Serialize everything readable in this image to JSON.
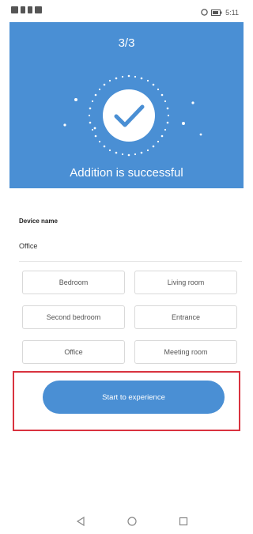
{
  "status_bar": {
    "time": "5:11",
    "icons": [
      "signal-icon",
      "wifi-icon",
      "notification-icon",
      "alarm-icon",
      "battery-icon"
    ]
  },
  "setup": {
    "step": "3/3",
    "success_message": "Addition is successful",
    "icon": "checkmark-icon",
    "colors": {
      "accent": "#4a8fd4",
      "highlight": "#d9333f"
    }
  },
  "device": {
    "label": "Device name",
    "value": "Office"
  },
  "rooms": [
    "Bedroom",
    "Living room",
    "Second bedroom",
    "Entrance",
    "Office",
    "Meeting room"
  ],
  "cta": {
    "label": "Start to experience"
  },
  "navigation": {
    "icons": [
      "back-icon",
      "home-icon",
      "recents-icon"
    ]
  }
}
